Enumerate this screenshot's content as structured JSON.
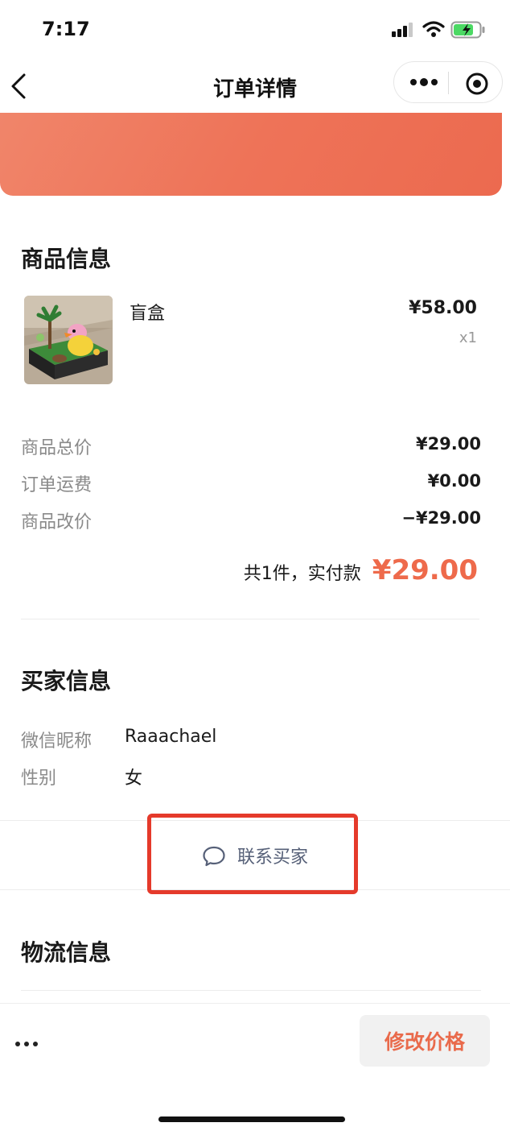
{
  "status_bar": {
    "time": "7:17"
  },
  "nav": {
    "title": "订单详情"
  },
  "colors": {
    "accent": "#ee6a4b",
    "banner": "#ee7358",
    "highlight": "#e53a2b",
    "link": "#566078"
  },
  "product_section": {
    "title": "商品信息",
    "item": {
      "name": "盲盒",
      "price": "¥58.00",
      "quantity": "x1"
    }
  },
  "summary": {
    "rows": [
      {
        "label": "商品总价",
        "value": "¥29.00"
      },
      {
        "label": "订单运费",
        "value": "¥0.00"
      },
      {
        "label": "商品改价",
        "value": "−¥29.00"
      }
    ],
    "total_label": "共1件，实付款",
    "total_amount": "¥29.00"
  },
  "buyer_section": {
    "title": "买家信息",
    "rows": [
      {
        "label": "微信昵称",
        "value": "Raaachael"
      },
      {
        "label": "性别",
        "value": "女"
      }
    ],
    "contact_label": "联系买家"
  },
  "logistics_section": {
    "title": "物流信息"
  },
  "bottom_bar": {
    "edit_price_label": "修改价格"
  },
  "icons": [
    "signal-icon",
    "wifi-icon",
    "battery-icon",
    "back-icon",
    "more-icon",
    "close-icon",
    "chat-icon",
    "more-dots-icon"
  ]
}
